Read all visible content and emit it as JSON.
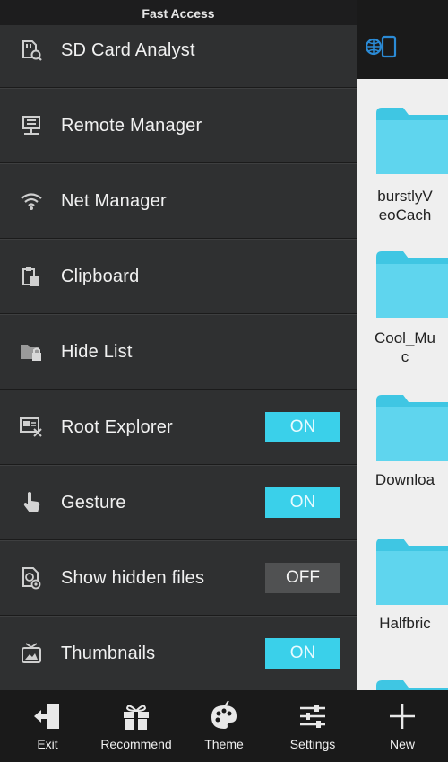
{
  "drawer": {
    "title": "Fast Access",
    "items": [
      {
        "label": "SD Card Analyst",
        "icon": "sd-card-icon"
      },
      {
        "label": "Remote Manager",
        "icon": "monitor-icon"
      },
      {
        "label": "Net Manager",
        "icon": "wifi-icon"
      },
      {
        "label": "Clipboard",
        "icon": "clipboard-icon"
      },
      {
        "label": "Hide List",
        "icon": "folder-lock-icon"
      },
      {
        "label": "Root Explorer",
        "icon": "root-icon",
        "toggle": "ON"
      },
      {
        "label": "Gesture",
        "icon": "hand-icon",
        "toggle": "ON"
      },
      {
        "label": "Show hidden files",
        "icon": "hidden-file-icon",
        "toggle": "OFF"
      },
      {
        "label": "Thumbnails",
        "icon": "image-icon",
        "toggle": "ON"
      }
    ]
  },
  "folders": [
    {
      "name": "burstlyV\neoCach"
    },
    {
      "name": "Cool_Mu\nc"
    },
    {
      "name": "Downloa"
    },
    {
      "name": "Halfbric"
    }
  ],
  "bottombar": {
    "exit": "Exit",
    "recommend": "Recommend",
    "theme": "Theme",
    "settings": "Settings",
    "new": "New"
  },
  "colors": {
    "accent": "#3ad0ea",
    "drawer_bg": "#2f3031",
    "toggle_off": "#505152"
  }
}
